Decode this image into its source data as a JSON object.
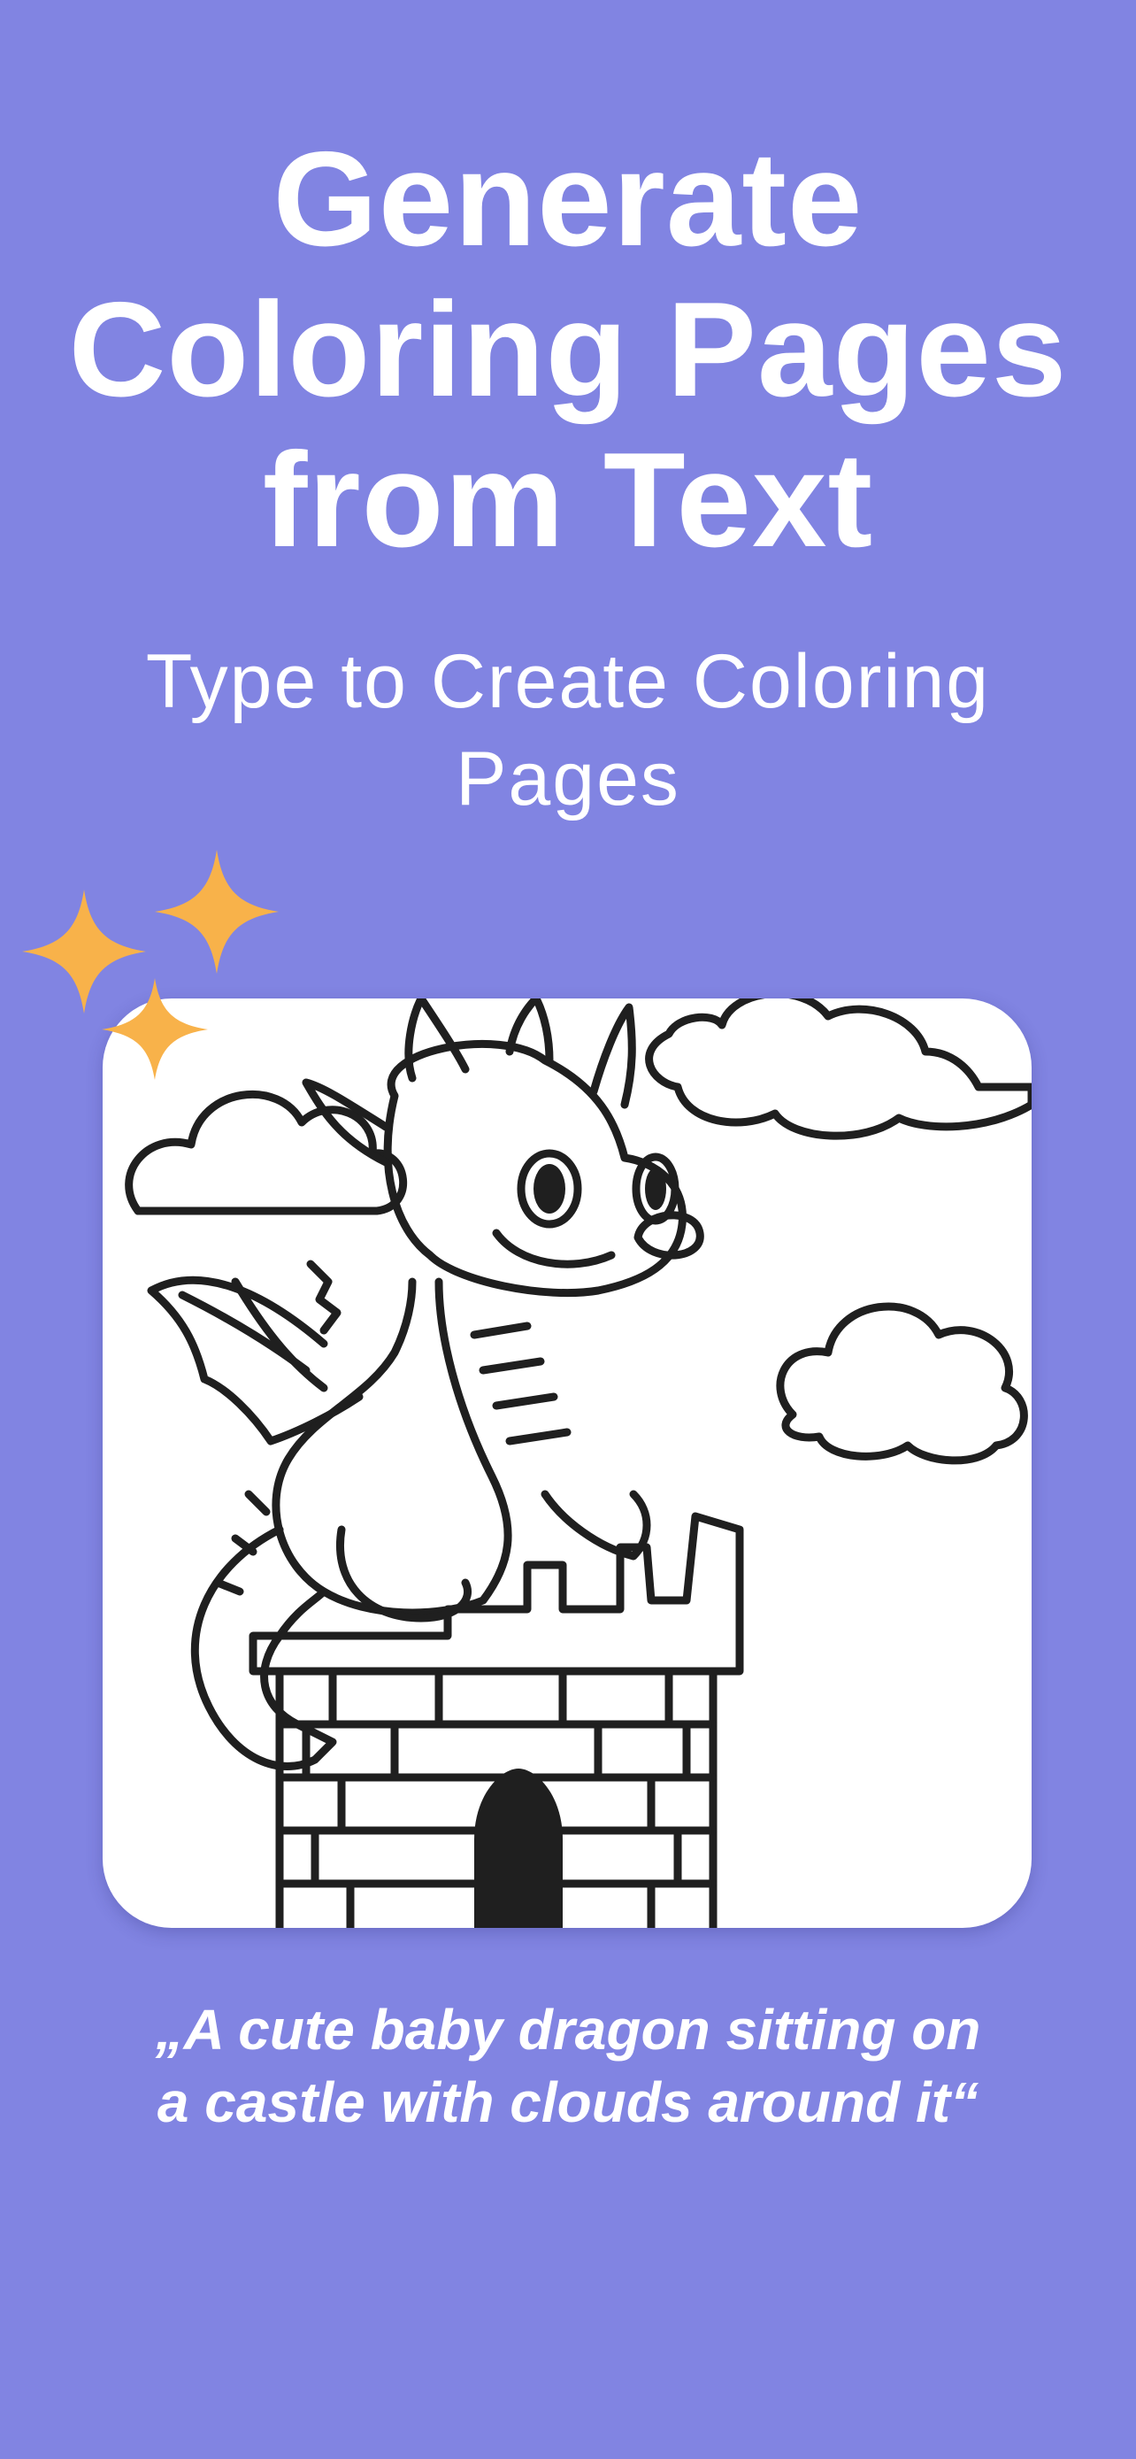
{
  "headline": {
    "line1": "Generate",
    "line2": "Coloring Pages",
    "line3": "from Text"
  },
  "subheadline": {
    "line1": "Type to Create Coloring",
    "line2": "Pages"
  },
  "prompt": {
    "line1": "„A cute baby dragon sitting on",
    "line2": "a castle with clouds around it“"
  },
  "colors": {
    "background": "#8184e2",
    "text": "#ffffff",
    "sparkle": "#f8b24a",
    "card": "#ffffff",
    "line_art": "#1f1f1f"
  },
  "icons": {
    "sparkles": "sparkles-icon"
  }
}
